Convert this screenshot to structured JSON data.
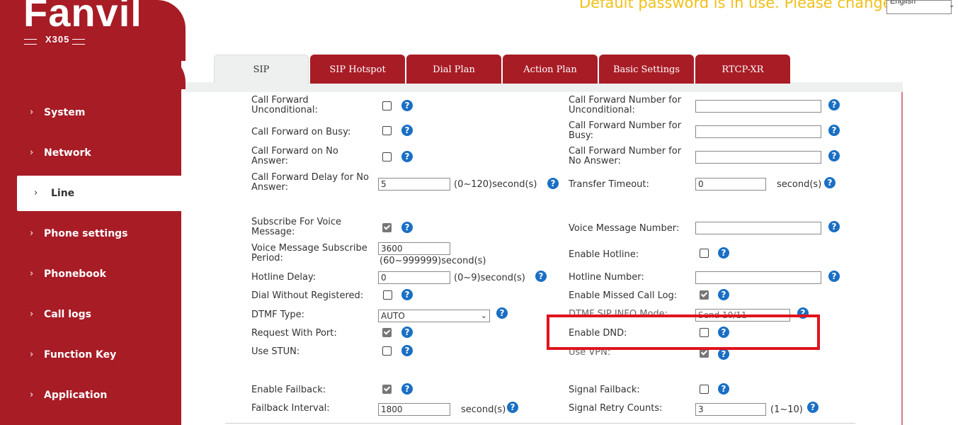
{
  "header": {
    "brand": "Fanvil",
    "model": "X305",
    "warning": "Default password is in use. Please change",
    "language": "English"
  },
  "sidebar": {
    "items": [
      {
        "label": "System"
      },
      {
        "label": "Network"
      },
      {
        "label": "Line"
      },
      {
        "label": "Phone settings"
      },
      {
        "label": "Phonebook"
      },
      {
        "label": "Call logs"
      },
      {
        "label": "Function Key"
      },
      {
        "label": "Application"
      }
    ],
    "active": "Line"
  },
  "tabs": [
    {
      "label": "SIP"
    },
    {
      "label": "SIP Hotspot"
    },
    {
      "label": "Dial Plan"
    },
    {
      "label": "Action Plan"
    },
    {
      "label": "Basic Settings"
    },
    {
      "label": "RTCP-XR"
    }
  ],
  "form": {
    "cfu": {
      "label": "Call Forward Unconditional:",
      "checked": false
    },
    "cfu_num": {
      "label": "Call Forward Number for Unconditional:",
      "value": ""
    },
    "cfb": {
      "label": "Call Forward on Busy:",
      "checked": false
    },
    "cfb_num": {
      "label": "Call Forward Number for Busy:",
      "value": ""
    },
    "cfna": {
      "label": "Call Forward on No Answer:",
      "checked": false
    },
    "cfna_num": {
      "label": "Call Forward Number for No Answer:",
      "value": ""
    },
    "cf_delay": {
      "label": "Call Forward Delay for No Answer:",
      "value": "5",
      "unit": "(0~120)second(s)"
    },
    "transfer_timeout": {
      "label": "Transfer Timeout:",
      "value": "0",
      "unit": "second(s)"
    },
    "sub_vm": {
      "label": "Subscribe For Voice Message:",
      "checked": true
    },
    "vm_number": {
      "label": "Voice Message Number:",
      "value": ""
    },
    "vm_period": {
      "label": "Voice Message Subscribe Period:",
      "value": "3600",
      "unit": "(60~999999)second(s)"
    },
    "hotline": {
      "label": "Enable Hotline:",
      "checked": false
    },
    "hotline_delay": {
      "label": "Hotline Delay:",
      "value": "0",
      "unit": "(0~9)second(s)"
    },
    "hotline_number": {
      "label": "Hotline Number:",
      "value": ""
    },
    "dial_unreg": {
      "label": "Dial Without Registered:",
      "checked": false
    },
    "missed_log": {
      "label": "Enable Missed Call Log:",
      "checked": true
    },
    "dtmf_type": {
      "label": "DTMF Type:",
      "value": "AUTO"
    },
    "dtmf_sip_info": {
      "label": "DTMF SIP INFO Mode:",
      "value": "Send 10/11"
    },
    "req_port": {
      "label": "Request With Port:",
      "checked": true
    },
    "dnd": {
      "label": "Enable DND:",
      "checked": false
    },
    "stun": {
      "label": "Use STUN:",
      "checked": false
    },
    "vpn": {
      "label": "Use VPN:",
      "checked": true
    },
    "failback": {
      "label": "Enable Failback:",
      "checked": true
    },
    "signal_failback": {
      "label": "Signal Failback:",
      "checked": false
    },
    "failback_interval": {
      "label": "Failback Interval:",
      "value": "1800",
      "unit": "second(s)"
    },
    "signal_retry": {
      "label": "Signal Retry Counts:",
      "value": "3",
      "unit": "(1~10)"
    }
  },
  "colors": {
    "brand_red": "#a81c26",
    "warning": "#f0c018",
    "help_blue": "#1a6fc4",
    "highlight": "#e0141e"
  },
  "icons": {
    "help": "question-circle-icon",
    "chevron": "chevron-right-icon"
  }
}
